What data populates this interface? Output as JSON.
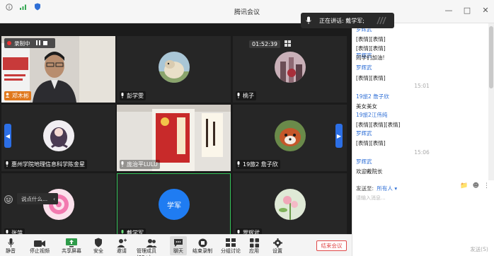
{
  "window": {
    "title": "腾讯会议"
  },
  "meeting": {
    "timer": "01:52:39",
    "speaking_label": "正在讲话: 戴学军;",
    "recording_label": "录制中",
    "chat_popup": "说点什么..."
  },
  "tiles": [
    {
      "name": "邓木彬"
    },
    {
      "name": "彭学雯"
    },
    {
      "name": "桃子"
    },
    {
      "name": "惠州学院地理信息科学陈金星"
    },
    {
      "name": "庞治平LULU"
    },
    {
      "name": "19旅2 詹子欣"
    },
    {
      "name": "张萍"
    },
    {
      "name": "戴学军",
      "avatar_text": "学军"
    },
    {
      "name": "罗辉武"
    }
  ],
  "toolbar": {
    "mute": "静音",
    "stop_video": "停止视频",
    "share_screen": "共享屏幕",
    "security": "安全",
    "invite": "邀请",
    "manage_members": "管理成员(99+)",
    "chat": "聊天",
    "end_record": "结束录制",
    "breakout": "分组讨论",
    "apps": "应用",
    "settings": "设置",
    "end_meeting": "结束会议"
  },
  "chat": {
    "messages": [
      {
        "type": "sender",
        "text": "罗辉武"
      },
      {
        "type": "body",
        "text": "[表情][表情]"
      },
      {
        "type": "body",
        "text": "[表情][表情]"
      },
      {
        "type": "sender",
        "text": "罗辉武"
      },
      {
        "type": "body",
        "text": "同学们加油!"
      },
      {
        "type": "sender",
        "text": "罗辉武"
      },
      {
        "type": "body",
        "text": "[表情][表情]"
      },
      {
        "type": "time",
        "text": "15:01"
      },
      {
        "type": "sender",
        "text": "19旅2 詹子欣"
      },
      {
        "type": "body",
        "text": "美女美女"
      },
      {
        "type": "sender",
        "text": "19旅2江伟纯"
      },
      {
        "type": "body",
        "text": "[表情][表情][表情]"
      },
      {
        "type": "sender",
        "text": "罗辉武"
      },
      {
        "type": "body",
        "text": "[表情][表情]"
      },
      {
        "type": "time",
        "text": "15:06"
      },
      {
        "type": "sender",
        "text": "罗辉武"
      },
      {
        "type": "body",
        "text": "欢迎戴院长"
      }
    ],
    "send_to_label": "发送至:",
    "send_to_target": "所有人",
    "input_placeholder": "请输入消息...",
    "send_button": "发送(S)"
  },
  "colors": {
    "accent": "#1f7cf2",
    "end_red": "#e04848",
    "active_border": "#35c35a",
    "chat_sender": "#2f6fd6"
  }
}
